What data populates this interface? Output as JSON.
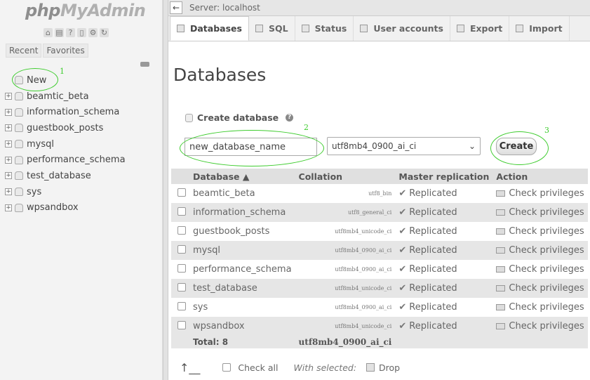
{
  "sidebar": {
    "logo_php": "php",
    "logo_myadmin": "MyAdmin",
    "tabs": [
      "Recent",
      "Favorites"
    ],
    "new_label": "New",
    "databases": [
      "beamtic_beta",
      "information_schema",
      "guestbook_posts",
      "mysql",
      "performance_schema",
      "test_database",
      "sys",
      "wpsandbox"
    ]
  },
  "topbar": {
    "server": "Server: localhost"
  },
  "tabs": [
    "Databases",
    "SQL",
    "Status",
    "User accounts",
    "Export",
    "Import"
  ],
  "main": {
    "title": "Databases",
    "create_label": "Create database",
    "db_name_value": "new_database_name",
    "collation_value": "utf8mb4_0900_ai_ci",
    "create_button": "Create"
  },
  "table": {
    "headers": [
      "Database",
      "Collation",
      "Master replication",
      "Action"
    ],
    "rows": [
      {
        "name": "beamtic_beta",
        "collation": "utf8_bin",
        "replication": "Replicated",
        "action": "Check privileges"
      },
      {
        "name": "information_schema",
        "collation": "utf8_general_ci",
        "replication": "Replicated",
        "action": "Check privileges"
      },
      {
        "name": "guestbook_posts",
        "collation": "utf8mb4_unicode_ci",
        "replication": "Replicated",
        "action": "Check privileges"
      },
      {
        "name": "mysql",
        "collation": "utf8mb4_0900_ai_ci",
        "replication": "Replicated",
        "action": "Check privileges"
      },
      {
        "name": "performance_schema",
        "collation": "utf8mb4_0900_ai_ci",
        "replication": "Replicated",
        "action": "Check privileges"
      },
      {
        "name": "test_database",
        "collation": "utf8mb4_unicode_ci",
        "replication": "Replicated",
        "action": "Check privileges"
      },
      {
        "name": "sys",
        "collation": "utf8mb4_0900_ai_ci",
        "replication": "Replicated",
        "action": "Check privileges"
      },
      {
        "name": "wpsandbox",
        "collation": "utf8mb4_unicode_ci",
        "replication": "Replicated",
        "action": "Check privileges"
      }
    ],
    "total_label": "Total: 8",
    "total_collation": "utf8mb4_0900_ai_ci"
  },
  "footer": {
    "check_all": "Check all",
    "with_selected": "With selected:",
    "drop": "Drop"
  },
  "annotations": [
    "1",
    "2",
    "3"
  ],
  "colors": {
    "annotation": "#3ecc2e"
  }
}
